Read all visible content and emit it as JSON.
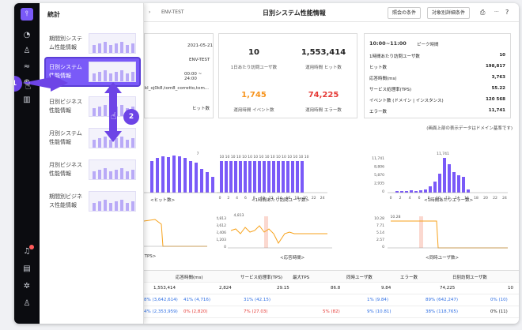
{
  "flyout": {
    "title": "統計",
    "items": [
      {
        "label": "期間別システム性能情報"
      },
      {
        "label": "日別システム性能情報"
      },
      {
        "label": "日別ビジネス性能情報"
      },
      {
        "label": "月別システム性能情報"
      },
      {
        "label": "月別ビジネス性能情報"
      },
      {
        "label": "期間別ビジネス性能情報"
      }
    ]
  },
  "callouts": [
    "1",
    "2"
  ],
  "header": {
    "crumb_sep": "›",
    "crumb": "ENV-TEST",
    "title": "日別システム性能情報",
    "btn_query": "照会の条件",
    "btn_detail": "対象別詳細条件"
  },
  "info": {
    "date": "2021-05-21",
    "env": "ENV-TEST",
    "time": "00:00 ~ 24:00",
    "domains": "kl_oj0k8,tom8_corretto,tom...",
    "hits_label": "ヒット数"
  },
  "kpis": [
    {
      "value": "10",
      "label": "1日あたり訪問ユーザ数"
    },
    {
      "value": "1,553,414",
      "label": "運用時間 ヒット数"
    },
    {
      "value": "1,745",
      "label": "運用時間 イベント数"
    },
    {
      "value": "74,225",
      "label": "運用時間 エラー数"
    }
  ],
  "peak": {
    "title": "10:00~11:00",
    "subtitle": "ピーク時間",
    "rows": [
      {
        "label": "1時間あたり訪問ユーザ数",
        "value": "10"
      },
      {
        "label": "ヒット数",
        "value": "198,817"
      },
      {
        "label": "応答時間(ms)",
        "value": "3,763"
      },
      {
        "label": "サービス処理率(TPS)",
        "value": "55.22"
      },
      {
        "label": "イベント数 (ドメイン | インスタンス)",
        "value": "120  568"
      },
      {
        "label": "エラー数",
        "value": "11,741"
      }
    ]
  },
  "note": "(画面上部の表示データはドメイン基準です)",
  "charts": {
    "c1": {
      "label": "<ヒット数>",
      "peak": "7"
    },
    "c2": {
      "label": "<1時間あたり訪問ユーザ数>",
      "peak_labels": "10 10 10 10 10 10 10 10 10 10 10 10 10 10 10 10"
    },
    "c3": {
      "label": "<1時間あたりエラー数>",
      "peak": "11,741",
      "y": [
        "11,741",
        "8,806",
        "5,870",
        "2,935",
        "0"
      ]
    },
    "c4": {
      "label": "<TPS>"
    },
    "c5": {
      "label": "<応答時間>",
      "peak": "4,813",
      "y": [
        "4,813",
        "3,612",
        "2,406",
        "1,203",
        "0"
      ]
    },
    "c6": {
      "label": "<同時ユーザ数>",
      "peak": "10.28",
      "y": [
        "10.28",
        "7.71",
        "5.14",
        "2.57",
        "0"
      ]
    },
    "x": [
      "0",
      "2",
      "4",
      "6",
      "8",
      "10",
      "12",
      "14",
      "16",
      "18",
      "20",
      "22",
      "24"
    ]
  },
  "table": {
    "headers": [
      "応答時間(ms)",
      "サービス処理率(TPS)",
      "最大TPS",
      "同時ユーザ数",
      "エラー数",
      "日別訪問ユーザ数"
    ],
    "rows": [
      [
        "1,553,414",
        "2,824",
        "29.15",
        "86.8",
        "9.84",
        "74,225",
        "10"
      ],
      [
        "8% (3,642,614)",
        "41% (4,716)",
        "31% (42.15)",
        "",
        "1% (9.84)",
        "89% (642,247)",
        "0% (10)"
      ],
      [
        "4% (2,353,959)",
        "0% (2,820)",
        "7% (27.03)",
        "5% (82)",
        "9% (10.81)",
        "38% (118,765)",
        "0% (11)"
      ]
    ]
  }
}
